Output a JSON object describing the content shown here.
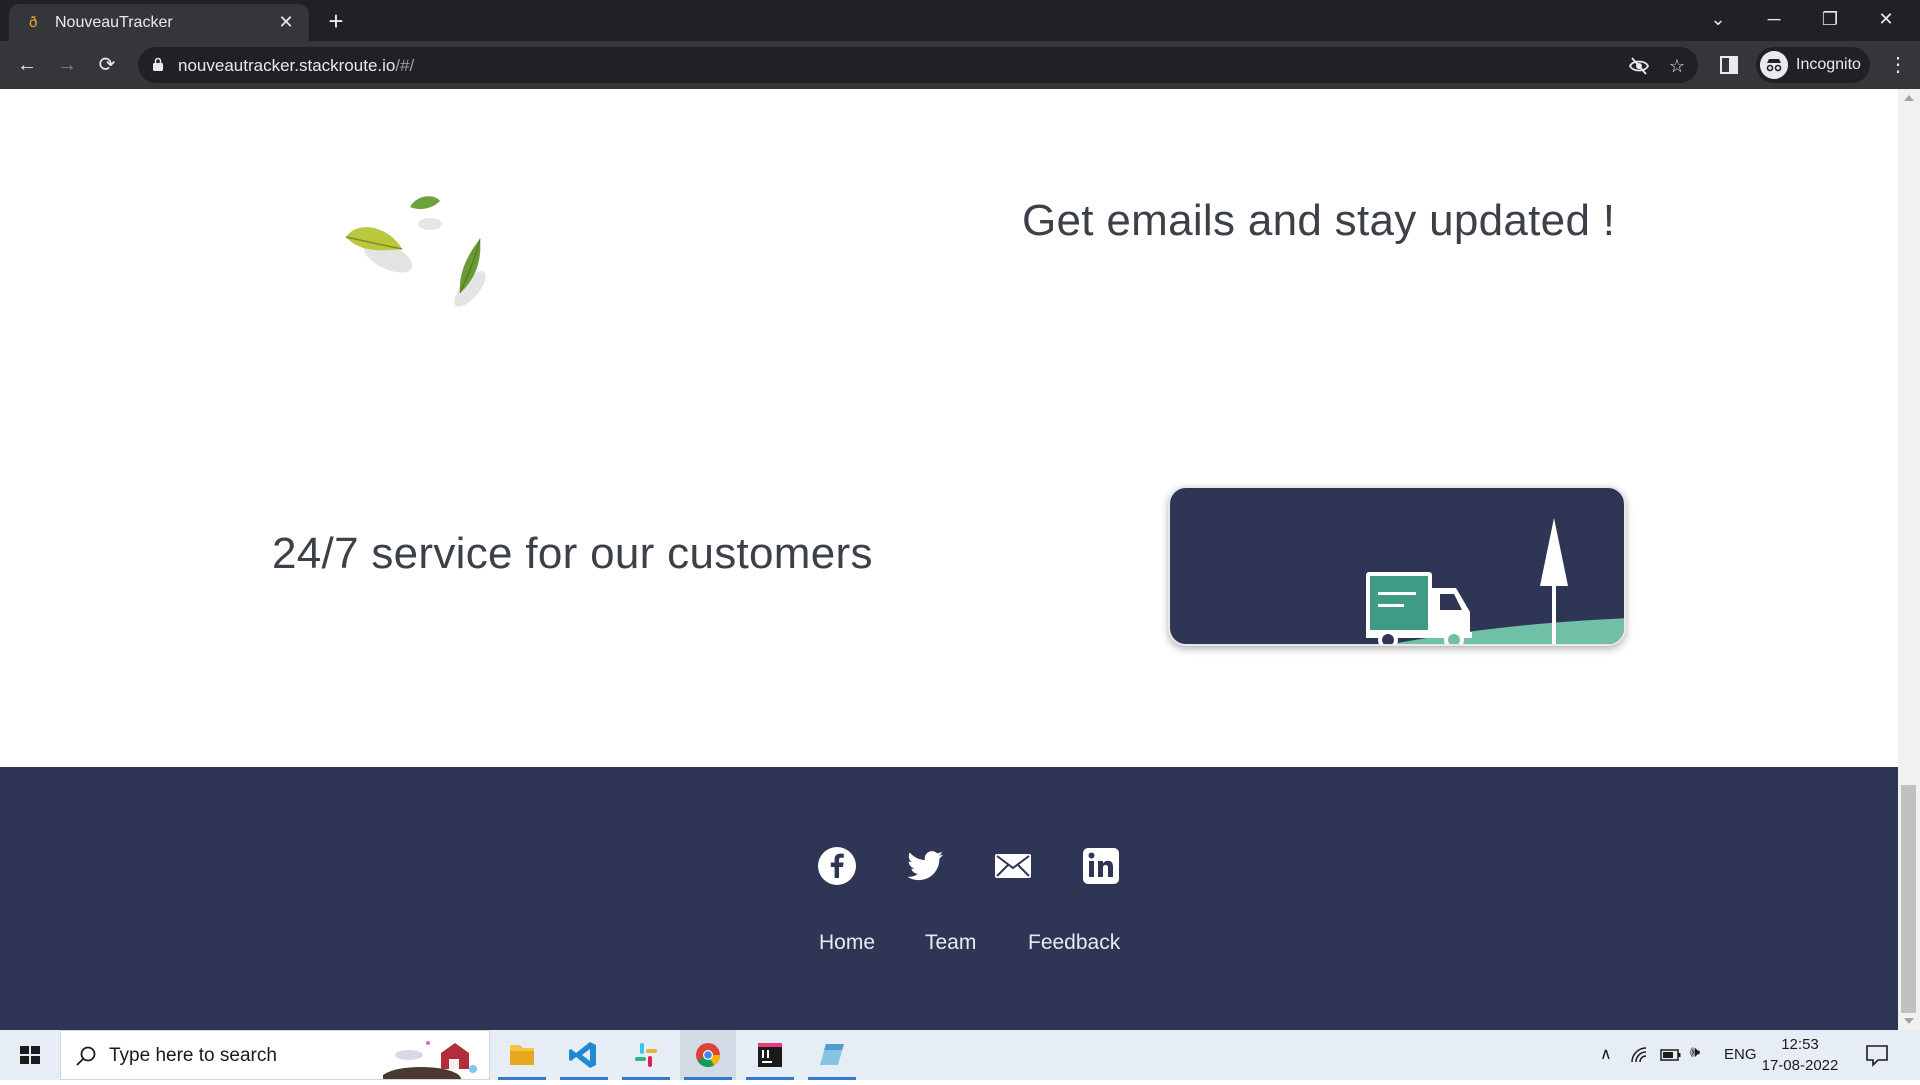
{
  "browser": {
    "tab_title": "NouveauTracker",
    "new_tab_label": "+",
    "url_host": "nouveautracker.stackroute.io",
    "url_path": "/#/",
    "incognito_label": "Incognito"
  },
  "page": {
    "email_headline": "Get emails and stay updated !",
    "service_headline": "24/7 service for our customers"
  },
  "footer": {
    "links": [
      "Home",
      "Team",
      "Feedback"
    ],
    "social_icons": [
      "facebook-icon",
      "twitter-icon",
      "mail-icon",
      "linkedin-icon"
    ]
  },
  "taskbar": {
    "search_placeholder": "Type here to search",
    "language": "ENG",
    "time": "12:53",
    "date": "17-08-2022"
  },
  "colors": {
    "footer_bg": "#2f3655",
    "card_bg": "#2f3655",
    "truck_green": "#3f9a86",
    "hill_green": "#6fc0a7"
  }
}
